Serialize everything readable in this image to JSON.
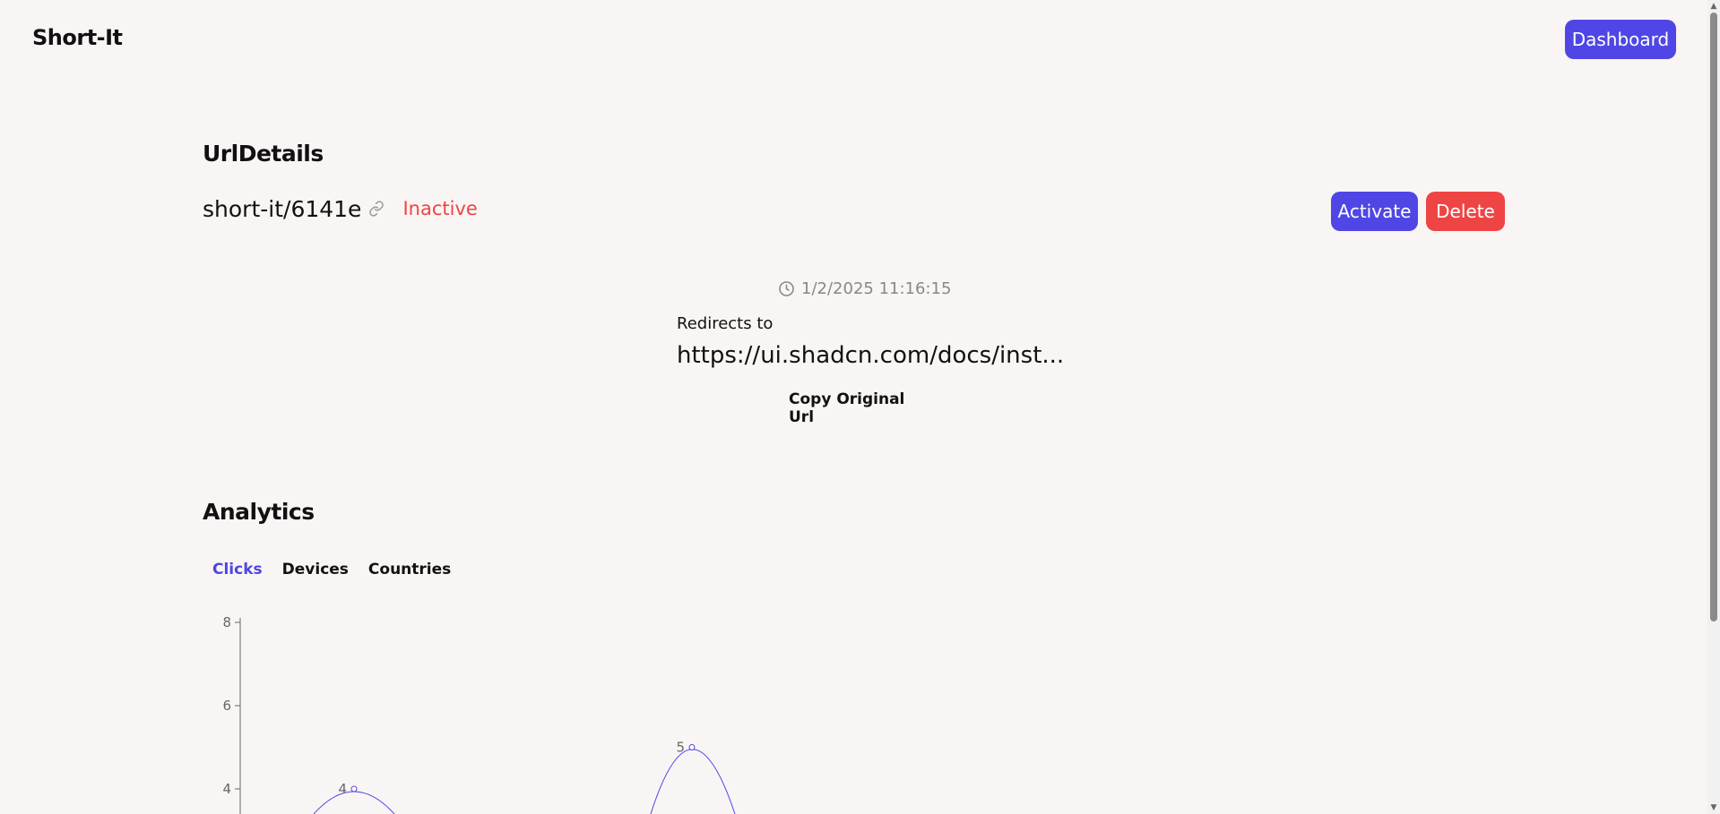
{
  "header": {
    "brand": "Short-It",
    "dashboard_label": "Dashboard"
  },
  "details": {
    "title": "UrlDetails",
    "short_url": "short-it/6141e",
    "status": "Inactive",
    "activate_label": "Activate",
    "delete_label": "Delete",
    "timestamp": "1/2/2025 11:16:15",
    "redirect_label": "Redirects to",
    "original_url": "https://ui.shadcn.com/docs/inst...",
    "copy_label": "Copy Original Url"
  },
  "analytics": {
    "title": "Analytics",
    "tabs": [
      {
        "label": "Clicks",
        "active": true
      },
      {
        "label": "Devices",
        "active": false
      },
      {
        "label": "Countries",
        "active": false
      }
    ]
  },
  "colors": {
    "accent": "#4f46e5",
    "danger": "#ef4444",
    "background": "#f9f5f4",
    "muted": "#888888"
  },
  "icons": {
    "link": "link-icon",
    "clock": "clock-icon"
  },
  "chart_data": {
    "type": "line",
    "yticks": [
      4,
      6,
      8
    ],
    "ylim": [
      2,
      8
    ],
    "points": [
      {
        "x": 1,
        "y": 4,
        "label": "4"
      },
      {
        "x": 2,
        "y": 5,
        "label": "5"
      }
    ],
    "grid": false,
    "color": "#4f46e5"
  }
}
